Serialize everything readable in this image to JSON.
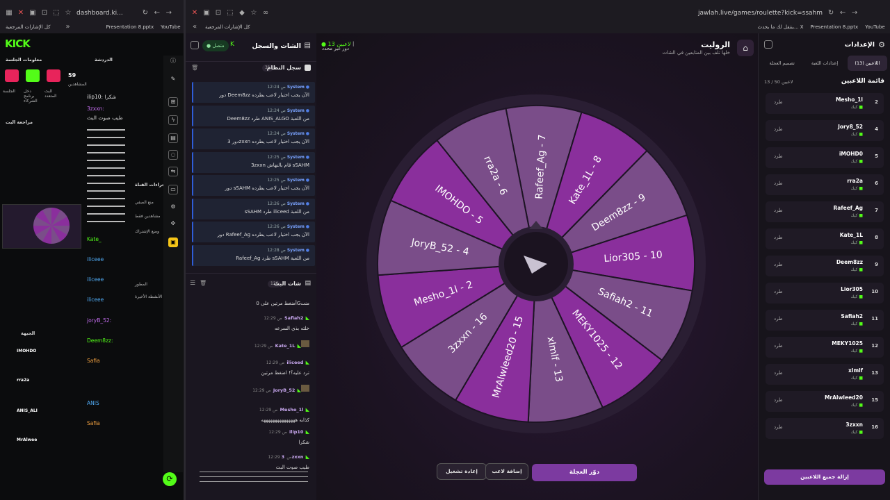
{
  "browser_left": {
    "address": "dashboard.ki...",
    "bookmarks": [
      "كل الإشارات المرجعية",
      "Presentation 8.pptx",
      "YouTube"
    ]
  },
  "browser_right": {
    "address": "jawlah.live/games/roulette?kick=ssahm",
    "bookmarks": [
      "كل الإشارات المرجعية",
      "Presentation 8.pptx",
      "YouTube",
      "ينتقل لك ما يحدث... X"
    ]
  },
  "kick": {
    "logo": "KICK",
    "session_title": "معلومات الجلسة",
    "session_count": "59",
    "session_count_label": "المشاهدين",
    "tiles": [
      "البث المتعدد",
      "دخل برنامج الشركاء",
      "الجلسة"
    ],
    "stream_preview_title": "مراجعة البث",
    "chat_title": "الدردشة",
    "chat_lines": [
      "ilip10: شكرا",
      "3zxxn:",
      "طيب صوت البث",
      "Kate_",
      "iliceee",
      "iliceee",
      "iliceee",
      "joryB_52:",
      "Deem8zz:",
      "Safia",
      "ANIS",
      "Safia"
    ],
    "mod_panel_title": "إجراءات القناة",
    "mod_items": [
      "منع الصفي",
      "مشاهدين فقط",
      "وضع الإشتراك",
      "المطور",
      "الأنشطة الأخيرة"
    ],
    "bottom_names": [
      "IMOHDO",
      "rra2a",
      "ANIS_ALI",
      "MrAlwee"
    ],
    "bottom_title": "الجبهة"
  },
  "chat": {
    "title": "الشات والسجل",
    "status": "متصل",
    "log_title": "سجل النظام",
    "log_count": "31",
    "system_sender": "System",
    "log": [
      {
        "time": "12:24 ص",
        "text": "دور Deem8zz الآن يجب اختيار لاعب يطرده"
      },
      {
        "time": "12:24 ص",
        "text": "Deem8zz طرد ANIS_ALGO من اللعبة"
      },
      {
        "time": "12:24 ص",
        "text": "دور 3zxxn الآن يجب اختيار لاعب يطرده"
      },
      {
        "time": "12:25 ص",
        "text": "3zxxn قام بالنهاش sSAHM"
      },
      {
        "time": "12:25 ص",
        "text": "دور sSAHM الآن يجب اختيار لاعب يطرده"
      },
      {
        "time": "12:26 ص",
        "text": "sSAHM طرد iliceed من اللعبة"
      },
      {
        "time": "12:26 ص",
        "text": "دور Rafeef_Ag الآن يجب اختيار لاعب يطرده"
      },
      {
        "time": "12:28 ص",
        "text": "Rafeef_Ag طرد sSAHM من اللعبة"
      }
    ],
    "stream_chat_title": "شات البث",
    "stream_chat_count": "120",
    "messages": [
      {
        "who": "",
        "time": "",
        "text": "أضغط مرتين على 0Gمنت"
      },
      {
        "who": "Safiah2",
        "time": "12:29 ص",
        "text": "خلته بذي السرعه"
      },
      {
        "who": "Kate_1L",
        "time": "12:29 ص",
        "text": ""
      },
      {
        "who": "iliceed",
        "time": "12:29 ص",
        "text": "ترد عليه؟! اضغط مرتين"
      },
      {
        "who": "JoryB_52",
        "time": "12:29 ص",
        "text": ""
      },
      {
        "who": "Mesho_1l",
        "time": "12:29 ص",
        "text": "كذابه هههههههههههههههه"
      },
      {
        "who": "ilip10",
        "time": "12:29 ص",
        "text": "شكرا"
      },
      {
        "who": "3zxxn",
        "time": "12:29 ص",
        "text": "طيب صوت البث"
      }
    ]
  },
  "wheel": {
    "title": "الروليت",
    "subtitle": "خلها تلف بين المتابعين في الشات",
    "players_badge": "13 لاعبين",
    "turn_label": "دور غير محدد",
    "segments": [
      "Rafeef_Ag - 7",
      "Kate_1L - 8",
      "Deem8zz - 9",
      "Lior305 - 10",
      "Safiah2 - 11",
      "MEKY1025 - 12",
      "xlmlf - 13",
      "MrAlwleed20 - 15",
      "3zxxn - 16",
      "Mesho_1l - 2",
      "JoryB_52 - 4",
      "IMOHDO - 5",
      "rra2a - 6"
    ],
    "colors": [
      "#7a4d89",
      "#8a2f9c"
    ],
    "spin_button": "دوّر العجلة",
    "add_player_button": "إضافة لاعب",
    "restart_button": "إعادة تشغيل"
  },
  "settings": {
    "title": "الإعدادات",
    "tabs": [
      "اللاعبين (13)",
      "إعدادات اللعبة",
      "تصميم العجلة"
    ],
    "list_title": "قائمة اللاعبين",
    "count": "13 / 50 لاعبين",
    "kick_label": "طرد",
    "platform": "كيك",
    "players": [
      {
        "num": "2",
        "name": "Mesho_1l"
      },
      {
        "num": "4",
        "name": "Jory8_52"
      },
      {
        "num": "5",
        "name": "iMOHD0"
      },
      {
        "num": "6",
        "name": "rra2a"
      },
      {
        "num": "7",
        "name": "Rafeef_Ag"
      },
      {
        "num": "8",
        "name": "Kate_1L"
      },
      {
        "num": "9",
        "name": "Deem8zz"
      },
      {
        "num": "10",
        "name": "Lior305"
      },
      {
        "num": "11",
        "name": "Safiah2"
      },
      {
        "num": "12",
        "name": "MEKY1025"
      },
      {
        "num": "13",
        "name": "xlmlf"
      },
      {
        "num": "15",
        "name": "MrAlwleed20"
      },
      {
        "num": "16",
        "name": "3zxxn"
      }
    ],
    "remove_all_button": "إزالة جميع اللاعبين"
  }
}
